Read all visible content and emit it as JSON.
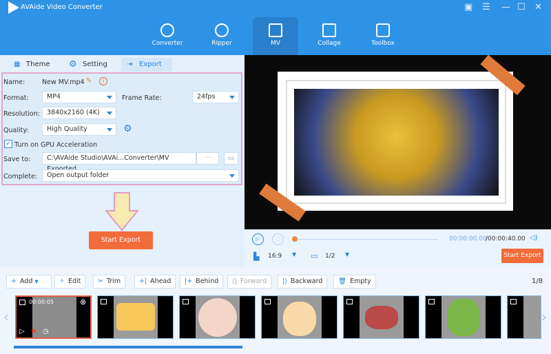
{
  "app": {
    "title": "AVAide Video Converter"
  },
  "nav": [
    {
      "label": "Converter",
      "icon": "converter-icon"
    },
    {
      "label": "Ripper",
      "icon": "disc-icon"
    },
    {
      "label": "MV",
      "icon": "tv-icon",
      "active": true
    },
    {
      "label": "Collage",
      "icon": "collage-icon"
    },
    {
      "label": "Toolbox",
      "icon": "toolbox-icon"
    }
  ],
  "tabs": {
    "theme": "Theme",
    "setting": "Setting",
    "export": "Export"
  },
  "form": {
    "name_label": "Name:",
    "name_value": "New MV.mp4",
    "format_label": "Format:",
    "format_value": "MP4",
    "frame_rate_label": "Frame Rate:",
    "frame_rate_value": "24fps",
    "resolution_label": "Resolution:",
    "resolution_value": "3840x2160 (4K)",
    "quality_label": "Quality:",
    "quality_value": "High Quality",
    "gpu_label": "Turn on GPU Acceleration",
    "gpu_checked": true,
    "save_label": "Save to:",
    "save_value": "C:\\AVAide Studio\\AVAi...Converter\\MV Exported",
    "browse": "···",
    "complete_label": "Complete:",
    "complete_value": "Open output folder"
  },
  "start_export": "Start Export",
  "player": {
    "current": "00:00:00.00",
    "total": "/00:00:40.00",
    "progress": 0,
    "aspect": "16:9",
    "page": "1/2",
    "start_export": "Start Export"
  },
  "toolbar": {
    "add": "Add",
    "edit": "Edit",
    "trim": "Trim",
    "ahead": "Ahead",
    "behind": "Behind",
    "forward": "Forward",
    "backward": "Backward",
    "empty": "Empty",
    "count": "1/8"
  },
  "clips": [
    {
      "name": "boy",
      "duration": "00:00:05"
    },
    {
      "name": "cheese"
    },
    {
      "name": "fish"
    },
    {
      "name": "chicken"
    },
    {
      "name": "steak"
    },
    {
      "name": "vegetables"
    },
    {
      "name": "bowl"
    }
  ],
  "colors": {
    "accent": "#2e93e6",
    "orange": "#f26b3a"
  }
}
